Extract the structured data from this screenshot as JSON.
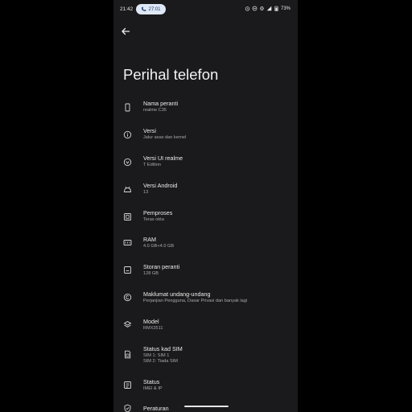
{
  "status_bar": {
    "time": "21:42",
    "call_pill": "27:01",
    "battery": "73%"
  },
  "page": {
    "title": "Perihal telefon"
  },
  "items": [
    {
      "title": "Nama peranti",
      "subtitle": "realme C35",
      "icon": "phone-icon"
    },
    {
      "title": "Versi",
      "subtitle": "Jalur asas dan kernel",
      "icon": "info-icon"
    },
    {
      "title": "Versi UI realme",
      "subtitle": "T Edition",
      "icon": "realme-ui-icon"
    },
    {
      "title": "Versi Android",
      "subtitle": "13",
      "icon": "android-icon"
    },
    {
      "title": "Pemproses",
      "subtitle": "Teras okta",
      "icon": "processor-icon"
    },
    {
      "title": "RAM",
      "subtitle": "4.0 GB+4.0 GB",
      "icon": "ram-icon"
    },
    {
      "title": "Storan peranti",
      "subtitle": "128 GB",
      "icon": "storage-icon"
    },
    {
      "title": "Maklumat undang-undang",
      "subtitle": "Perjanjian Pengguna, Dasar Privasi dan banyak lagi",
      "icon": "copyright-icon"
    },
    {
      "title": "Model",
      "subtitle": "RMX3511",
      "icon": "layers-icon"
    },
    {
      "title": "Status kad SIM",
      "subtitle": "SIM 1: SIM 1",
      "subtitle2": "SIM 2: Tiada SIM",
      "icon": "sim-card-icon"
    },
    {
      "title": "Status",
      "subtitle": "IMEI & IP",
      "icon": "status-icon"
    },
    {
      "title": "Peraturan",
      "subtitle": "",
      "icon": "shield-check-icon"
    }
  ]
}
